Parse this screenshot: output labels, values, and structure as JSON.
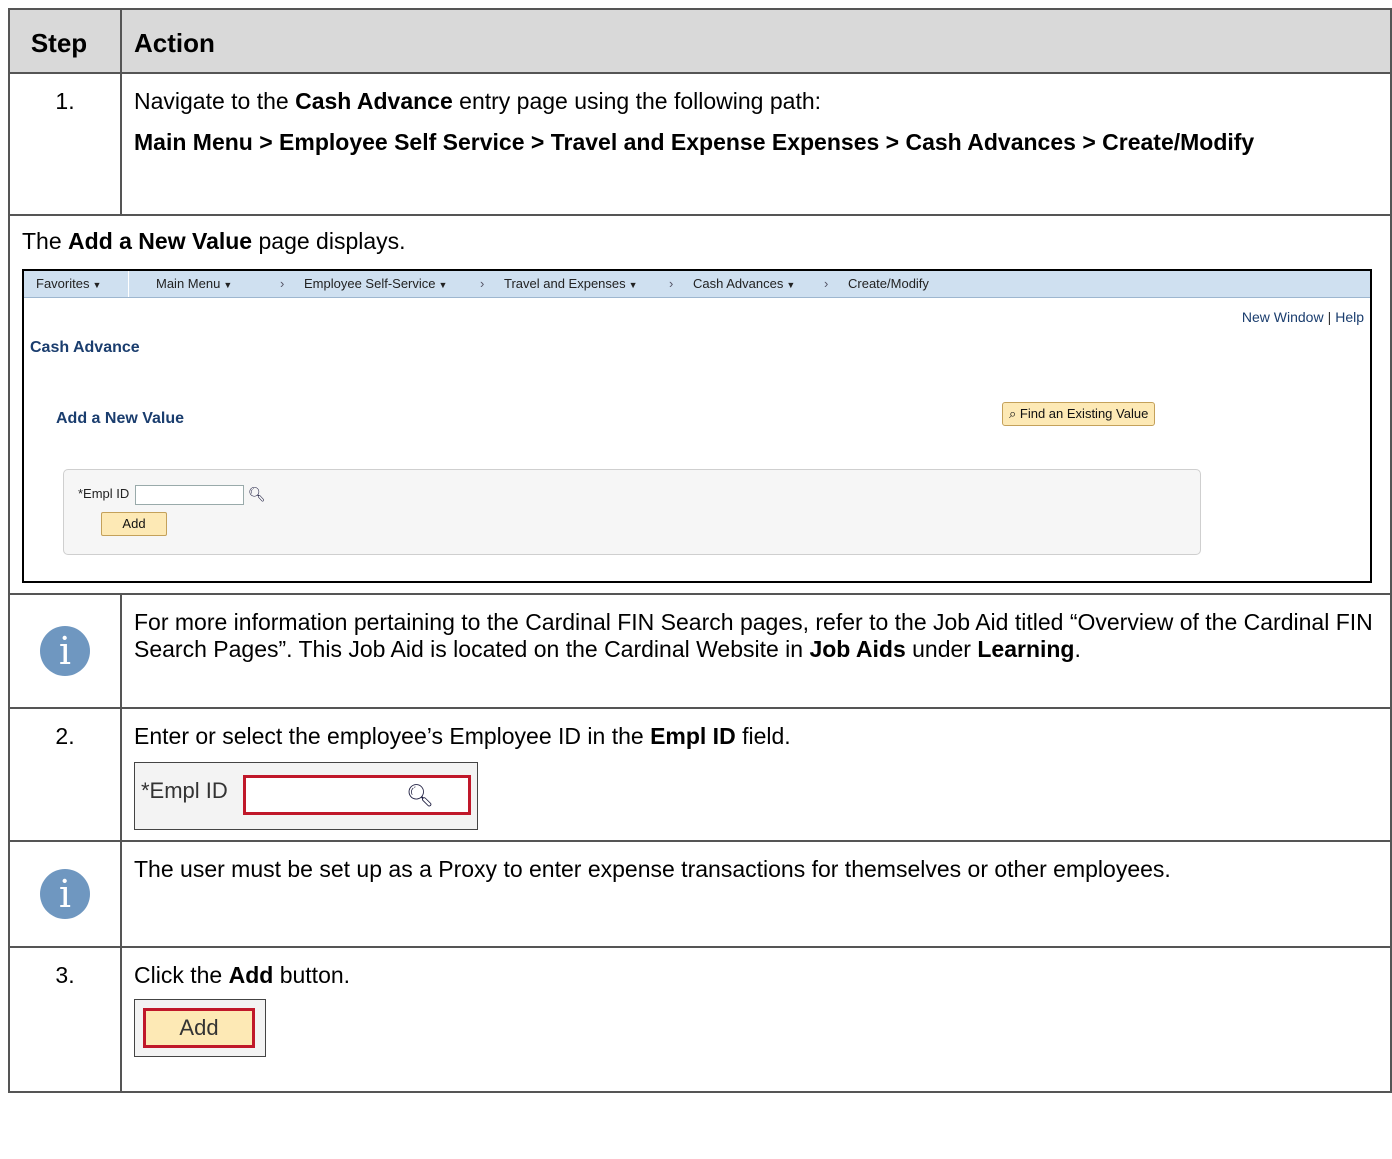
{
  "header": {
    "step": "Step",
    "action": "Action"
  },
  "step1": {
    "num": "1.",
    "line1_a": "Navigate to the ",
    "line1_b": "Cash Advance",
    "line1_c": " entry page using the following path:",
    "path": "Main Menu > Employee Self Service > Travel and Expense Expenses > Cash Advances > Create/Modify"
  },
  "page_note": {
    "a": "The ",
    "b": "Add a New Value",
    "c": " page displays."
  },
  "screenshot": {
    "nav": {
      "favorites": "Favorites",
      "main_menu": "Main Menu",
      "ess": "Employee Self-Service",
      "travel": "Travel and Expenses",
      "cash_adv": "Cash Advances",
      "create": "Create/Modify"
    },
    "new_window": "New Window",
    "help": "Help",
    "title": "Cash Advance",
    "find_btn": "Find an Existing Value",
    "add_new": "Add a New Value",
    "empl_label": "*Empl ID",
    "add_btn": "Add"
  },
  "info1": {
    "a": "For more information pertaining to the Cardinal FIN Search pages, refer to the Job Aid titled “Overview of the Cardinal FIN Search Pages”.  This Job Aid is located on the Cardinal Website in ",
    "b": "Job Aids",
    "c": " under ",
    "d": "Learning",
    "e": "."
  },
  "step2": {
    "num": "2.",
    "a": "Enter or select the employee’s Employee ID in the ",
    "b": "Empl ID",
    "c": " field.",
    "callout_label": "*Empl ID"
  },
  "info2": {
    "text": "The user must be set up as a Proxy to enter expense transactions for themselves or other employees."
  },
  "step3": {
    "num": "3.",
    "a": "Click the ",
    "b": "Add",
    "c": " button.",
    "callout_btn": "Add"
  },
  "colors": {
    "header_bg": "#d9d9d9",
    "info_icon": "#6f97c0",
    "highlight": "#c0182a",
    "ps_button": "#fde9b5",
    "ps_nav": "#cfe0f0",
    "ps_title": "#1a3d6e"
  }
}
